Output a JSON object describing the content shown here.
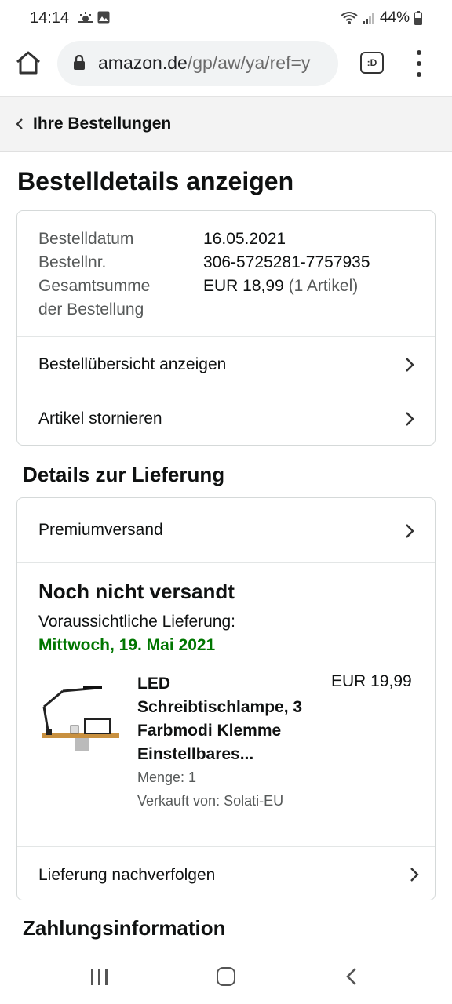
{
  "status_bar": {
    "time": "14:14",
    "battery": "44%"
  },
  "browser": {
    "url_host": "amazon.de",
    "url_path": "/gp/aw/ya/ref=y",
    "tab_icon_text": ":D"
  },
  "breadcrumb": {
    "label": "Ihre Bestellungen"
  },
  "page_title": "Bestelldetails anzeigen",
  "order_info": {
    "date_label": "Bestelldatum",
    "date_value": "16.05.2021",
    "number_label": "Bestellnr.",
    "number_value": "306-5725281-7757935",
    "total_label_line1": "Gesamtsumme",
    "total_label_line2": "der Bestellung",
    "total_value": "EUR 18,99",
    "total_count": "(1 Artikel)"
  },
  "order_links": {
    "summary": "Bestellübersicht anzeigen",
    "cancel": "Artikel stornieren"
  },
  "delivery_section_title": "Details zur Lieferung",
  "delivery": {
    "shipping_method": "Premiumversand",
    "status": "Noch nicht versandt",
    "estimate_label": "Voraussichtliche Lieferung:",
    "estimate_date": "Mittwoch, 19. Mai 2021",
    "track_link": "Lieferung nachverfolgen"
  },
  "product": {
    "title": "LED Schreibtischlampe, 3 Farbmodi Klemme Einstellbares...",
    "price": "EUR 19,99",
    "quantity": "Menge: 1",
    "seller": "Verkauft von: Solati-EU"
  },
  "payment_section_title": "Zahlungsinformation",
  "colors": {
    "accent_green": "#007600",
    "text": "#0f1111",
    "muted": "#565959",
    "border": "#d5d9d9"
  }
}
